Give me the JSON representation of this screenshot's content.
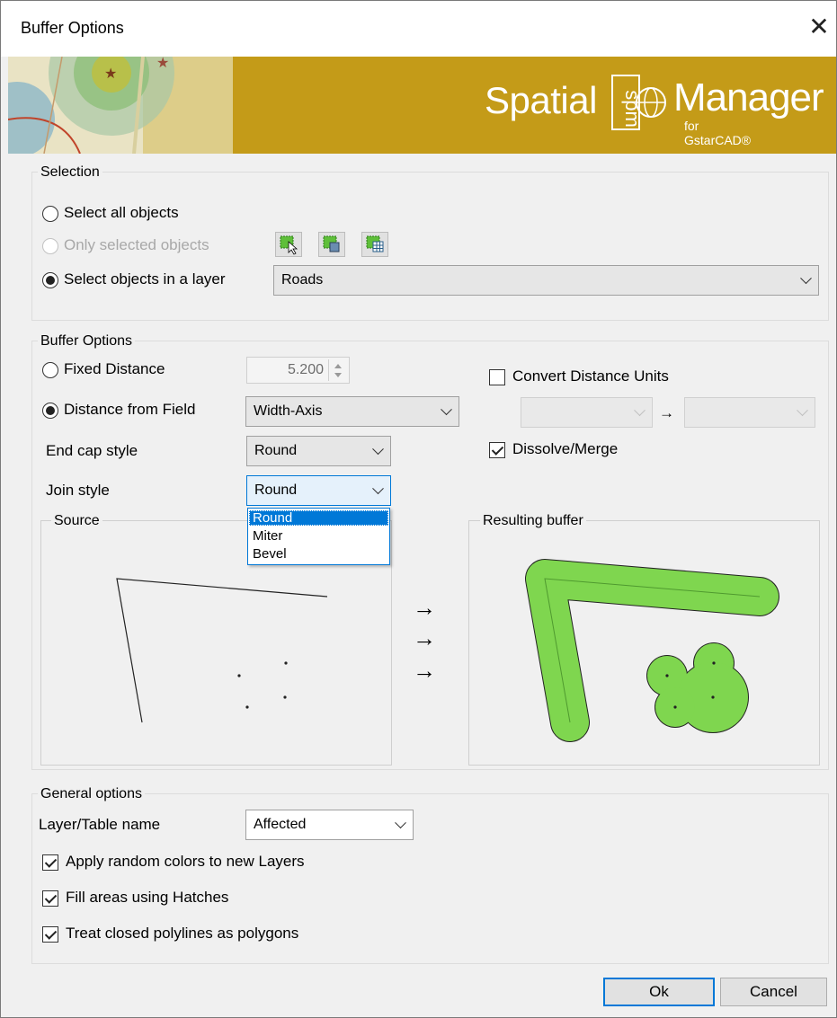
{
  "window": {
    "title": "Buffer Options",
    "close_glyph": "✕"
  },
  "banner": {
    "word1": "Spatial",
    "logo_text": "spm",
    "word2": "Manager",
    "sub": "for GstarCAD®"
  },
  "selection": {
    "group_label": "Selection",
    "all_label": "Select all objects",
    "only_selected_label": "Only selected objects",
    "layer_label": "Select objects in a layer",
    "layer_value": "Roads",
    "icons": [
      "select-objects-icon",
      "select-by-layer-icon",
      "select-from-table-icon"
    ]
  },
  "buffer": {
    "group_label": "Buffer Options",
    "fixed_label": "Fixed Distance",
    "fixed_value": "5.200",
    "field_label": "Distance from Field",
    "field_value": "Width-Axis",
    "convert_label": "Convert Distance Units",
    "convert_arrow": "→",
    "endcap_label": "End cap style",
    "endcap_value": "Round",
    "dissolve_label": "Dissolve/Merge",
    "join_label": "Join style",
    "join_value": "Round",
    "join_options": [
      "Round",
      "Miter",
      "Bevel"
    ],
    "source_label": "Source",
    "result_label": "Resulting buffer",
    "flow_arrows": [
      "→",
      "→",
      "→"
    ]
  },
  "general": {
    "group_label": "General options",
    "layer_name_label": "Layer/Table name",
    "layer_name_value": "Affected",
    "random_colors_label": "Apply random colors to new Layers",
    "hatches_label": "Fill areas using Hatches",
    "closed_poly_label": "Treat closed polylines as polygons"
  },
  "footer": {
    "ok_label": "Ok",
    "cancel_label": "Cancel"
  },
  "colors": {
    "banner": "#c49b18",
    "buffer_fill": "#7fd64f",
    "accent": "#0078d7"
  }
}
